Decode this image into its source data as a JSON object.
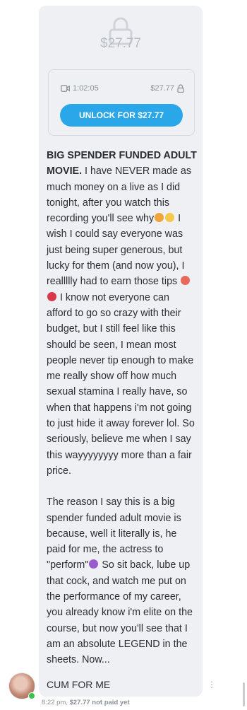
{
  "post": {
    "locked_price": "$27.77",
    "duration": "1:02:05",
    "card_price": "$27.77",
    "unlock_label": "UNLOCK FOR $27.77",
    "title": "BIG SPENDER FUNDED ADULT MOVIE.",
    "body_a": " I have NEVER made as much money on a live as I did tonight, after you watch this recording you'll see why",
    "body_b": " I wish I could say everyone was just being super generous, but lucky for them (and now you), I reallllly had to earn those tips ",
    "body_c": " I know not everyone can afford to go so crazy with their budget, but I still feel like this should be seen, I mean most people never tip enough to make me really show off how much sexual stamina I really have, so when that happens i'm not going to just hide it away forever lol. So seriously, believe me when I say this wayyyyyyyy more than a fair price.",
    "para2_a": "The reason I say this is a big spender funded adult movie is because, well it literally is, he paid for me, the actress to \"perform\"",
    "para2_b": " So sit back, lube up that cock, and watch me put on the performance of my career, you already know i'm elite on the course, but now you'll see that I am an absolute LEGEND in the sheets. Now...",
    "closing": "CUM FOR ME"
  },
  "footer": {
    "time": "8:22 pm, ",
    "price_status": "$27.77 not paid yet"
  },
  "icons": {
    "lock": "lock-icon",
    "video": "video-icon",
    "more": "more-vertical-icon"
  },
  "colors": {
    "accent": "#29a7e8",
    "bubble": "#eef0f3",
    "online": "#3ac24b"
  }
}
